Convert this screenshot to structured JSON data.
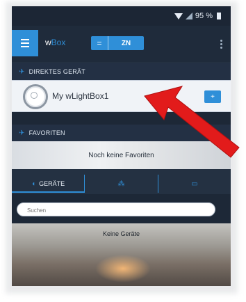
{
  "status": {
    "battery": "95 %"
  },
  "appbar": {
    "brand_w": "w",
    "brand_box": "Box",
    "toggle_label": "ZN"
  },
  "direct_device": {
    "header": "DIREKTES GERÄT",
    "device_name": "My wLightBox1",
    "add_button": "+"
  },
  "favorites": {
    "header": "FAVORITEN",
    "empty": "Noch keine Favoriten"
  },
  "tabs": [
    {
      "label": "GERÄTE",
      "icon": "device-icon",
      "active": true
    },
    {
      "label": "",
      "icon": "group-icon",
      "active": false
    },
    {
      "label": "",
      "icon": "scene-icon",
      "active": false
    }
  ],
  "search": {
    "placeholder": "Suchen"
  },
  "devices": {
    "empty": "Keine Geräte"
  },
  "colors": {
    "accent": "#2f8fd8",
    "arrow": "#e21b1b",
    "header_bg": "#233044"
  }
}
